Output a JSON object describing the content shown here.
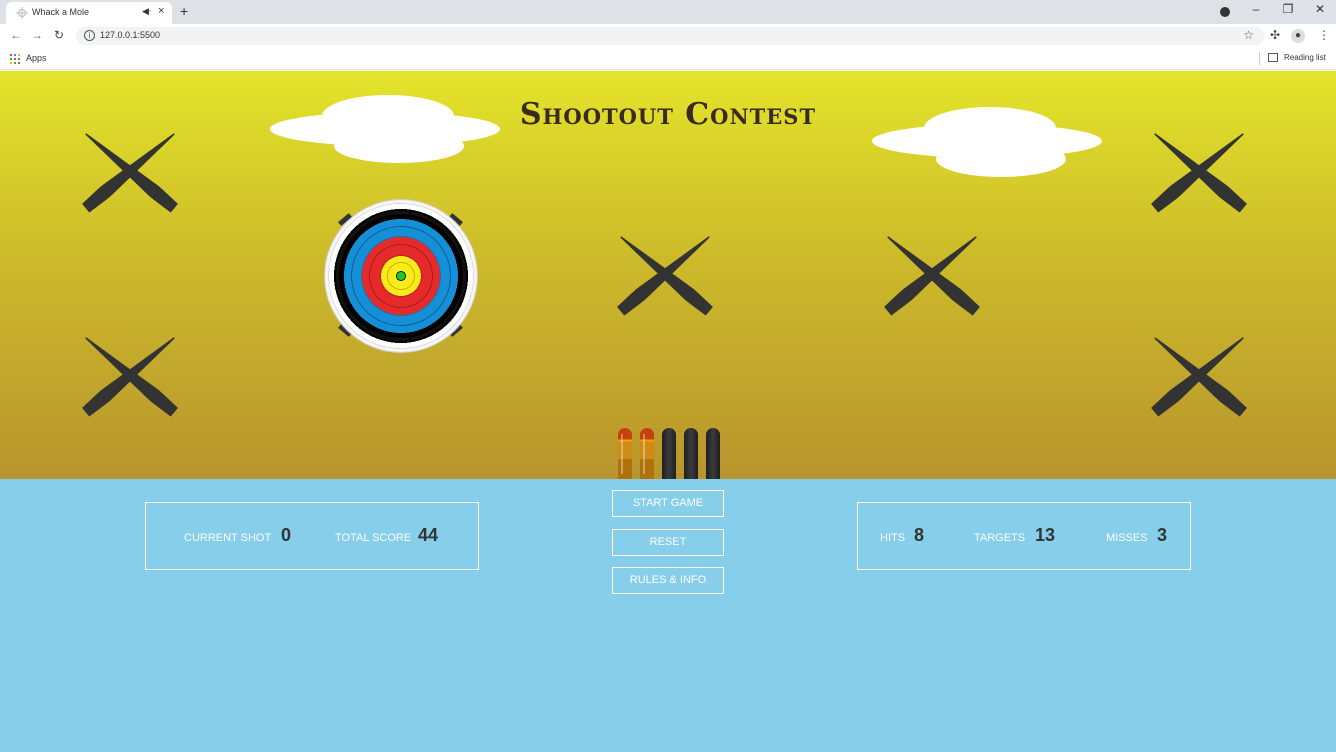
{
  "browser": {
    "tab_title": "Whack a Mole",
    "tab_audio_icon": "speaker-icon",
    "tab_close": "×",
    "new_tab": "+",
    "url": "127.0.0.1:5500",
    "bookmarks_apps": "Apps",
    "reading_list": "Reading list",
    "window_controls": [
      "–",
      "❐",
      "✕"
    ]
  },
  "game": {
    "title": "Shootout Contest",
    "colors": {
      "sky_top": "#e3e42a",
      "sky_bottom": "#b8952d",
      "dashboard": "#87ceeb",
      "cross": "#333333"
    },
    "ammo": {
      "total": 5,
      "remaining": 2
    }
  },
  "stats": {
    "current_shot_label": "Current Shot",
    "current_shot_value": "0",
    "total_score_label": "Total Score",
    "total_score_value": "44",
    "hits_label": "Hits",
    "hits_value": "8",
    "targets_label": "Targets",
    "targets_value": "13",
    "misses_label": "Misses",
    "misses_value": "3"
  },
  "controls": {
    "start_label": "Start Game",
    "reset_label": "Reset",
    "rules_label": "Rules & Info"
  }
}
